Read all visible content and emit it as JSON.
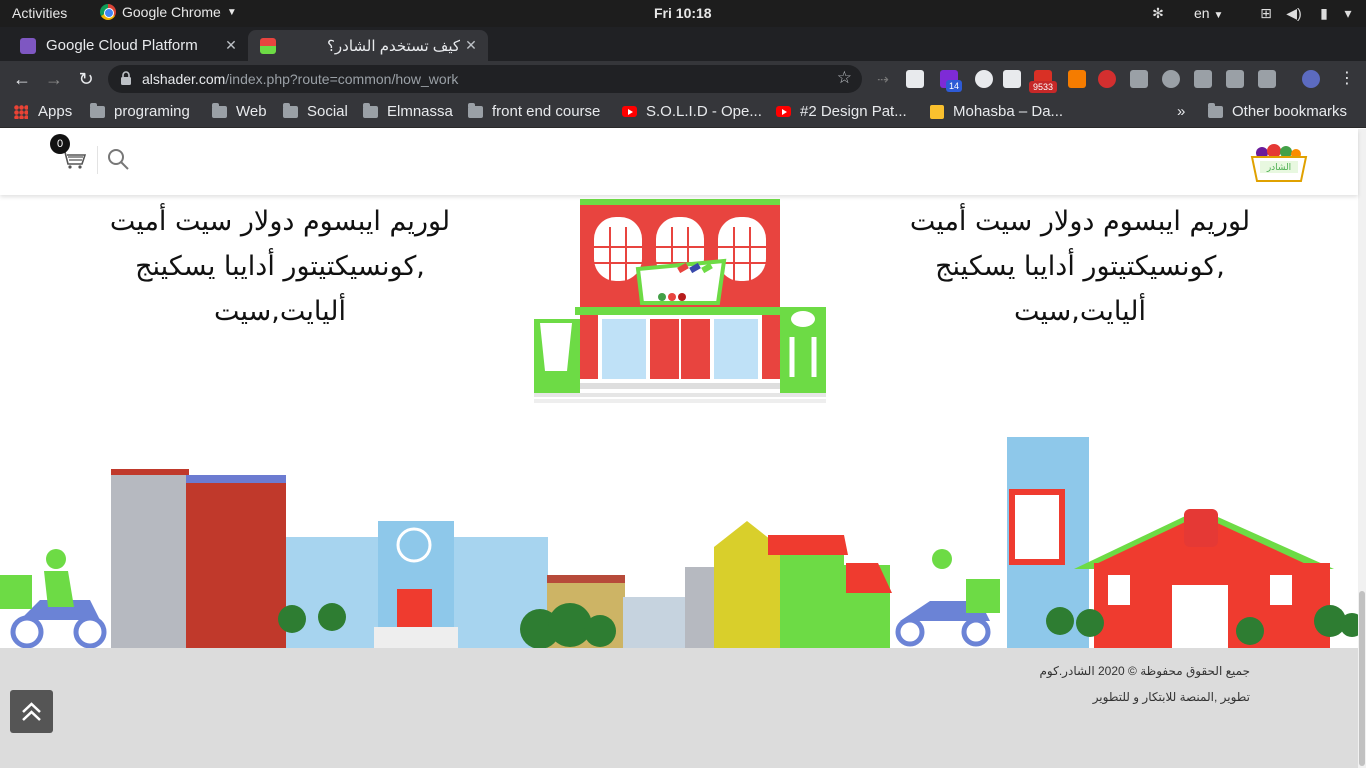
{
  "system_bar": {
    "activities": "Activities",
    "app_name": "Google Chrome",
    "clock": "Fri 10:18",
    "language": "en"
  },
  "tabs": [
    {
      "title": "Google Cloud Platform",
      "active": false
    },
    {
      "title": "كيف تستخدم الشادر؟",
      "active": true
    }
  ],
  "address_bar": {
    "host": "alshader.com",
    "path": "/index.php?route=common/how_work"
  },
  "extensions": {
    "badge_count_1": "14",
    "badge_count_2": "9533"
  },
  "bookmarks": {
    "items": [
      {
        "label": "Apps",
        "icon": "apps-grid-icon"
      },
      {
        "label": "programing",
        "icon": "folder-icon"
      },
      {
        "label": "Web",
        "icon": "folder-icon"
      },
      {
        "label": "Social",
        "icon": "folder-icon"
      },
      {
        "label": "Elmnassa",
        "icon": "folder-icon"
      },
      {
        "label": "front end course",
        "icon": "folder-icon"
      },
      {
        "label": "S.O.L.I.D - Ope...",
        "icon": "youtube-icon"
      },
      {
        "label": "#2 Design Pat...",
        "icon": "youtube-icon"
      },
      {
        "label": "Mohasba – Da...",
        "icon": "mohasba-icon"
      }
    ],
    "overflow": "»",
    "other": "Other bookmarks"
  },
  "header": {
    "cart_count": "0",
    "logo_text": "الشادر"
  },
  "content": {
    "left_text": "لوريم ايبسوم دولار سيت أميت ,كونسيكتيتور أدايبا يسكينج أليايت,سيت",
    "right_text": "لوريم ايبسوم دولار سيت أميت ,كونسيكتيتور أدايبا يسكينج أليايت,سيت"
  },
  "footer": {
    "copyright": "جميع الحقوق محفوظة © 2020 الشادر.كوم",
    "developer": "تطوير ,المنصة للابتكار و للتطوير"
  },
  "colors": {
    "brand_green": "#6ddb45",
    "brand_red": "#e8443f",
    "footer_bg": "#dcdcdc"
  }
}
